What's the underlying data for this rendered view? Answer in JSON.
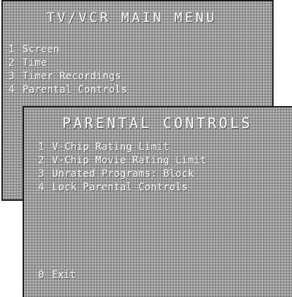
{
  "main_menu": {
    "title": "TV/VCR MAIN MENU",
    "items": [
      {
        "number": "1",
        "label": "Screen"
      },
      {
        "number": "2",
        "label": "Time"
      },
      {
        "number": "3",
        "label": "Timer Recordings"
      },
      {
        "number": "4",
        "label": "Parental Controls"
      }
    ]
  },
  "parental_controls": {
    "title": "PARENTAL CONTROLS",
    "items": [
      {
        "number": "1",
        "label": "V-Chip Rating Limit"
      },
      {
        "number": "2",
        "label": "V-Chip Movie Rating Limit"
      },
      {
        "number": "3",
        "label": "Unrated Programs: Block"
      },
      {
        "number": "4",
        "label": "Lock Parental Controls"
      }
    ],
    "exit": {
      "number": "0",
      "label": "Exit"
    }
  }
}
